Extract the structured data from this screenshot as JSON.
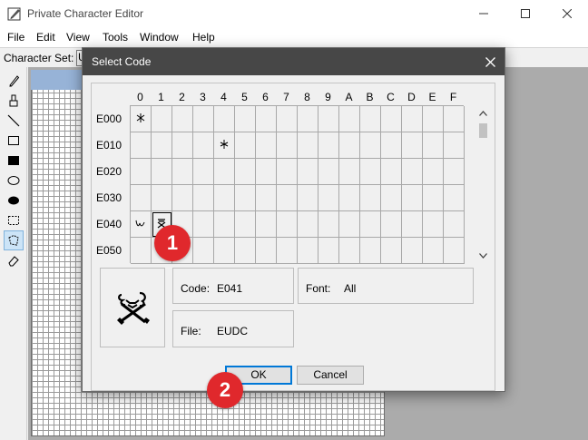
{
  "window": {
    "title": "Private Character Editor",
    "minimize_icon": "minimize-icon",
    "maximize_icon": "maximize-icon",
    "close_icon": "close-icon"
  },
  "menu": [
    "File",
    "Edit",
    "View",
    "Tools",
    "Window",
    "Help"
  ],
  "charset_bar": {
    "label": "Character Set:",
    "value": "U"
  },
  "toolbox": {
    "tools": [
      "pencil-icon",
      "brush-icon",
      "line-icon",
      "hollow-rectangle-icon",
      "filled-rectangle-icon",
      "hollow-ellipse-icon",
      "filled-ellipse-icon",
      "rectangular-selection-icon",
      "freeform-selection-icon",
      "eraser-icon"
    ],
    "active_tool": "freeform-selection-icon"
  },
  "dialog": {
    "title": "Select Code",
    "column_headers": [
      "0",
      "1",
      "2",
      "3",
      "4",
      "5",
      "6",
      "7",
      "8",
      "9",
      "A",
      "B",
      "C",
      "D",
      "E",
      "F"
    ],
    "row_headers": [
      "E000",
      "E010",
      "E020",
      "E030",
      "E040",
      "E050"
    ],
    "populated_cells": [
      {
        "row": 0,
        "col": 0,
        "glyph": "glyph-e000-icon"
      },
      {
        "row": 1,
        "col": 4,
        "glyph": "glyph-e014-icon"
      },
      {
        "row": 4,
        "col": 0,
        "glyph": "glyph-e040-icon"
      },
      {
        "row": 4,
        "col": 1,
        "glyph": "glyph-e041-icon"
      }
    ],
    "selected_cell": {
      "row": 4,
      "col": 1
    },
    "code_label": "Code:",
    "code_value": "E041",
    "font_label": "Font:",
    "font_value": "All",
    "file_label": "File:",
    "file_value": "EUDC",
    "ok_label": "OK",
    "cancel_label": "Cancel"
  },
  "annotations": [
    "1",
    "2"
  ],
  "colors": {
    "dialog_titlebar": "#474747",
    "badge": "#e0282c",
    "default_button_border": "#0078d7",
    "edit_grid_header": "#97b3d7"
  }
}
